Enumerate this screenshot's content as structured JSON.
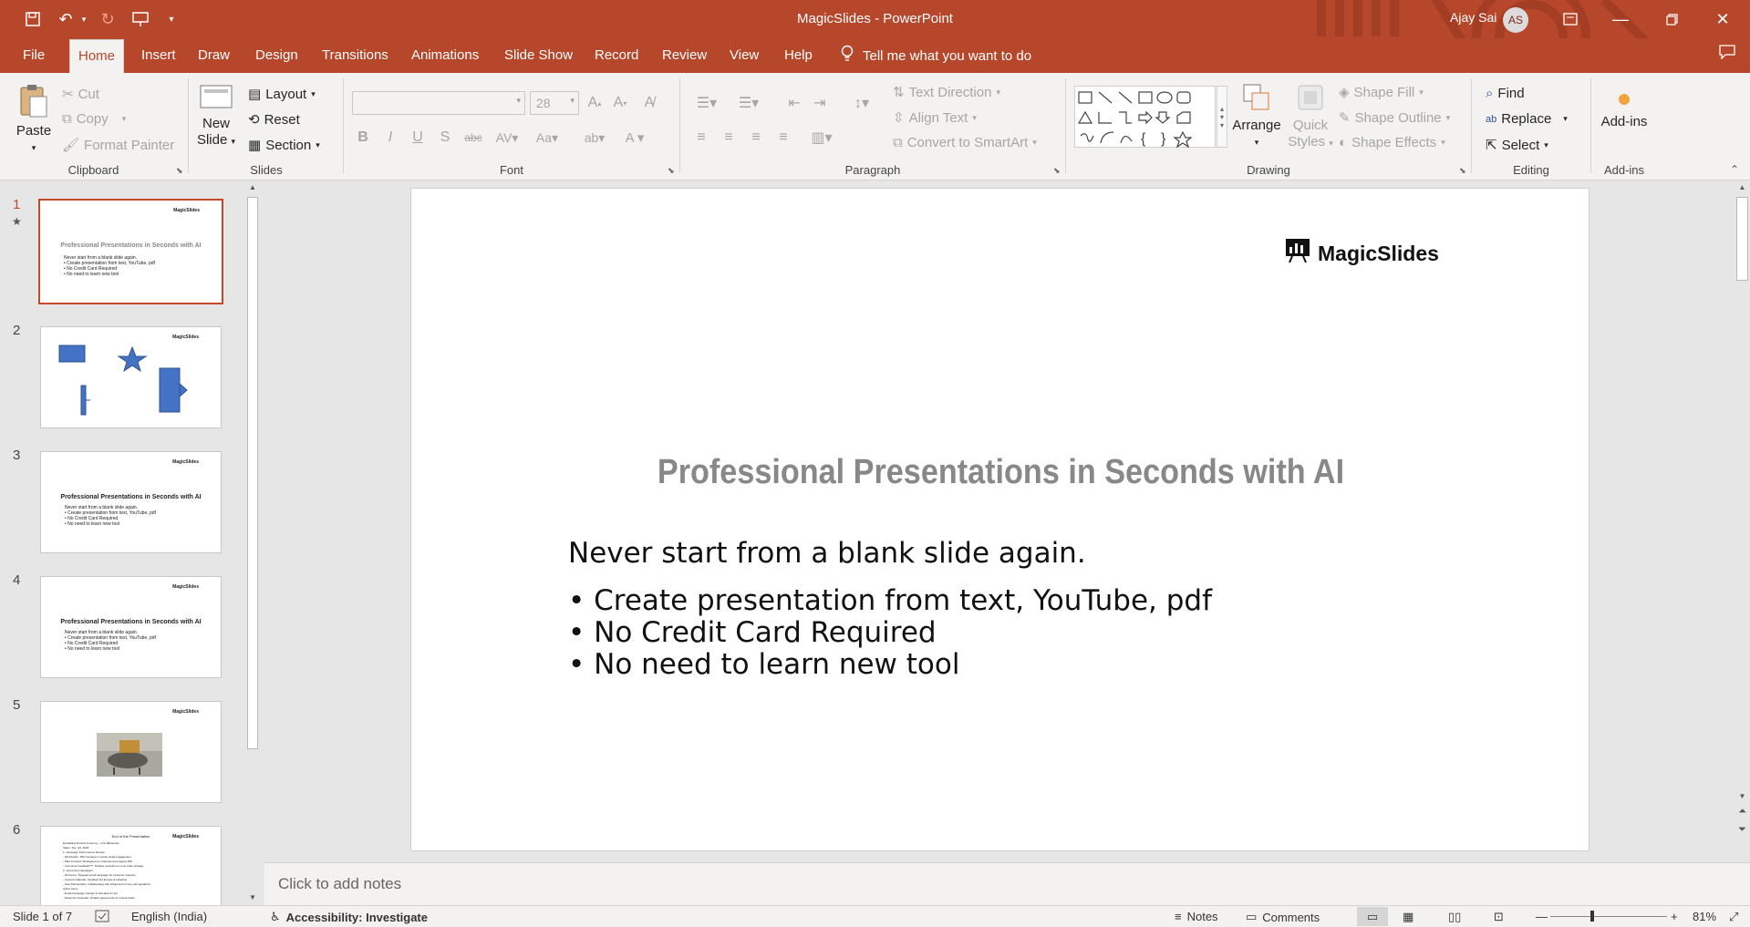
{
  "window": {
    "title": "MagicSlides  -  PowerPoint",
    "user_name": "Ajay Sai",
    "user_initials": "AS"
  },
  "colors": {
    "accent": "#b7472a",
    "ribbon_bg": "#f3f2f1",
    "shape_blue": "#4472c4"
  },
  "tabs": [
    {
      "label": "File"
    },
    {
      "label": "Home"
    },
    {
      "label": "Insert"
    },
    {
      "label": "Draw"
    },
    {
      "label": "Design"
    },
    {
      "label": "Transitions"
    },
    {
      "label": "Animations"
    },
    {
      "label": "Slide Show"
    },
    {
      "label": "Record"
    },
    {
      "label": "Review"
    },
    {
      "label": "View"
    },
    {
      "label": "Help"
    }
  ],
  "tell_me": "Tell me what you want to do",
  "ribbon": {
    "clipboard": {
      "label": "Clipboard",
      "paste": "Paste",
      "cut": "Cut",
      "copy": "Copy",
      "format_painter": "Format Painter"
    },
    "slides": {
      "label": "Slides",
      "new_slide_1": "New",
      "new_slide_2": "Slide",
      "layout": "Layout",
      "reset": "Reset",
      "section": "Section"
    },
    "font": {
      "label": "Font",
      "font_size": "28"
    },
    "paragraph": {
      "label": "Paragraph",
      "text_direction": "Text Direction",
      "align_text": "Align Text",
      "convert_smartart": "Convert to SmartArt"
    },
    "drawing": {
      "label": "Drawing",
      "arrange": "Arrange",
      "quick_styles_1": "Quick",
      "quick_styles_2": "Styles",
      "shape_fill": "Shape Fill",
      "shape_outline": "Shape Outline",
      "shape_effects": "Shape Effects"
    },
    "editing": {
      "label": "Editing",
      "find": "Find",
      "replace": "Replace",
      "select": "Select"
    },
    "addins": {
      "label": "Add-ins",
      "addins_button": "Add-ins"
    }
  },
  "thumbnails": [
    {
      "num": "1",
      "logo": "MagicSlides",
      "title": "Professional Presentations in Seconds with AI",
      "lines": [
        "Never start from a blank slide again.",
        "• Create presentation from text, YouTube, pdf",
        "• No Credit Card Required",
        "• No need to learn new tool"
      ]
    },
    {
      "num": "2",
      "logo": "MagicSlides"
    },
    {
      "num": "3",
      "logo": "MagicSlides",
      "title": "Professional Presentations in Seconds with AI",
      "lines": [
        "Never start from a blank slide again.",
        "• Create presentation from text, YouTube, pdf",
        "• No Credit Card Required",
        "• No need to learn new tool"
      ]
    },
    {
      "num": "4",
      "logo": "MagicSlides",
      "title": "Professional Presentations in Seconds with AI",
      "lines": [
        "Never start from a blank slide again.",
        "• Create presentation from text, YouTube, pdf",
        "• No Credit Card Required",
        "• No need to learn new tool"
      ]
    },
    {
      "num": "5",
      "logo": "MagicSlides"
    },
    {
      "num": "6",
      "logo": "MagicSlides",
      "title": "End of the Presentation",
      "lines": [
        "Escalating Product Inventory – Our Milestones",
        "Sales: July, Q3, 2024",
        "1. Campaign Performance Review",
        "- Q3 Results: 18% increase in social media engagement",
        "- Plan Forward: Strategized on channels and regions ROI",
        "- Consumer Feedback***: Positive reception on new video strategy",
        "2. Upcoming Campaigns",
        "- Q4 Focus: Targeted email campaign for customer retention",
        "- Content Calendar: Finalized Q4 themes & schedule",
        "- New Partnerships: Collaborating with influencers for key demographics",
        "Action Items",
        "- Email Campaign: Design & schedule for Q4",
        "- Influencer Outreach: Finalize agreements & content briefs"
      ]
    }
  ],
  "slide": {
    "logo": "MagicSlides",
    "title": "Professional Presentations in Seconds with AI",
    "subtitle": "Never start from a blank slide again.",
    "bullets": [
      "• Create presentation from text, YouTube, pdf",
      "• No Credit Card Required",
      "• No need to learn new tool"
    ]
  },
  "notes_placeholder": "Click to add notes",
  "status": {
    "slide_info": "Slide 1 of 7",
    "language": "English (India)",
    "accessibility": "Accessibility: Investigate",
    "notes": "Notes",
    "comments": "Comments",
    "zoom": "81%"
  }
}
